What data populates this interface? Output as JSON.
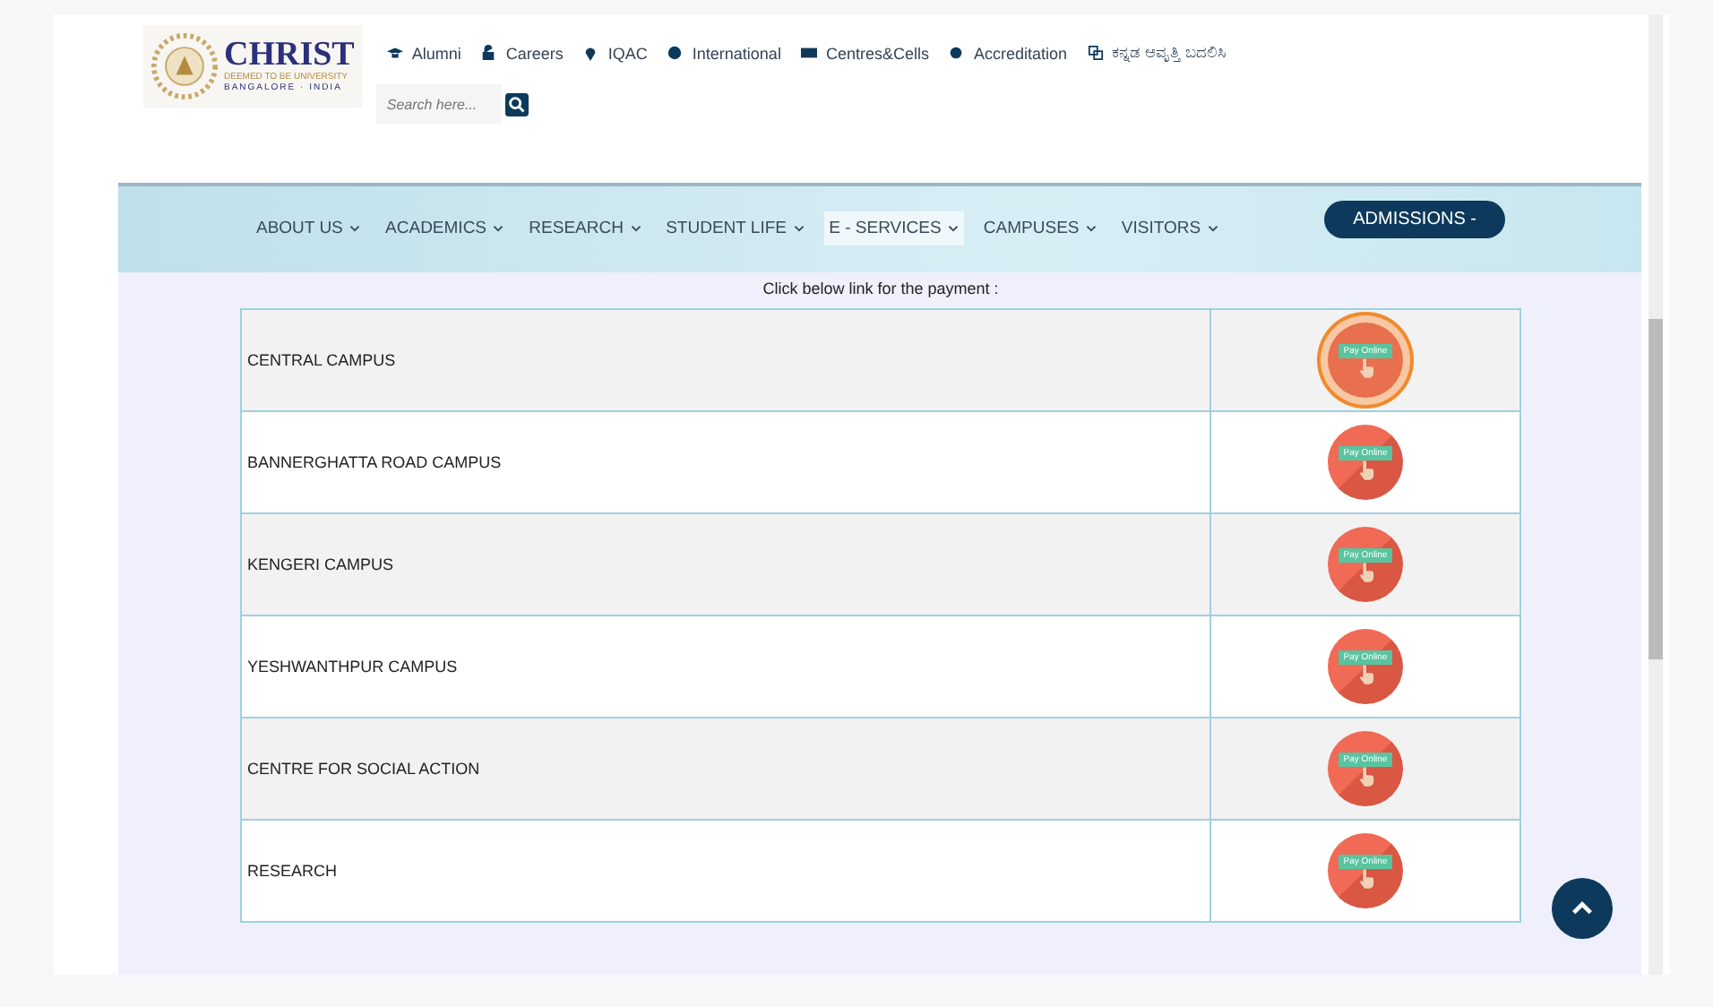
{
  "logo": {
    "name": "CHRIST",
    "tagline": "DEEMED TO BE UNIVERSITY",
    "location": "BANGALORE · INDIA"
  },
  "top_links": [
    {
      "label": "Alumni"
    },
    {
      "label": "Careers"
    },
    {
      "label": "IQAC"
    },
    {
      "label": "International"
    },
    {
      "label": "Centres&Cells"
    },
    {
      "label": "Accreditation"
    },
    {
      "label": "ಕನ್ನಡ ಆವೃತ್ತಿ ಬದಲಿಸಿ"
    }
  ],
  "search": {
    "placeholder": "Search here..."
  },
  "nav": [
    {
      "label": "ABOUT US",
      "selected": false
    },
    {
      "label": "ACADEMICS",
      "selected": false
    },
    {
      "label": "RESEARCH",
      "selected": false
    },
    {
      "label": "STUDENT LIFE",
      "selected": false
    },
    {
      "label": "E - SERVICES",
      "selected": true
    },
    {
      "label": "CAMPUSES",
      "selected": false
    },
    {
      "label": "VISITORS",
      "selected": false
    }
  ],
  "admissions_button": "ADMISSIONS -",
  "intro": "Click below link for the payment :",
  "rows": [
    {
      "campus": "CENTRAL CAMPUS",
      "button": "Pay Online",
      "highlighted": true
    },
    {
      "campus": "BANNERGHATTA ROAD CAMPUS",
      "button": "Pay Online",
      "highlighted": false
    },
    {
      "campus": "KENGERI CAMPUS",
      "button": "Pay Online",
      "highlighted": false
    },
    {
      "campus": "YESHWANTHPUR CAMPUS",
      "button": "Pay Online",
      "highlighted": false
    },
    {
      "campus": "CENTRE FOR SOCIAL ACTION",
      "button": "Pay Online",
      "highlighted": false
    },
    {
      "campus": "RESEARCH",
      "button": "Pay Online",
      "highlighted": false
    }
  ]
}
